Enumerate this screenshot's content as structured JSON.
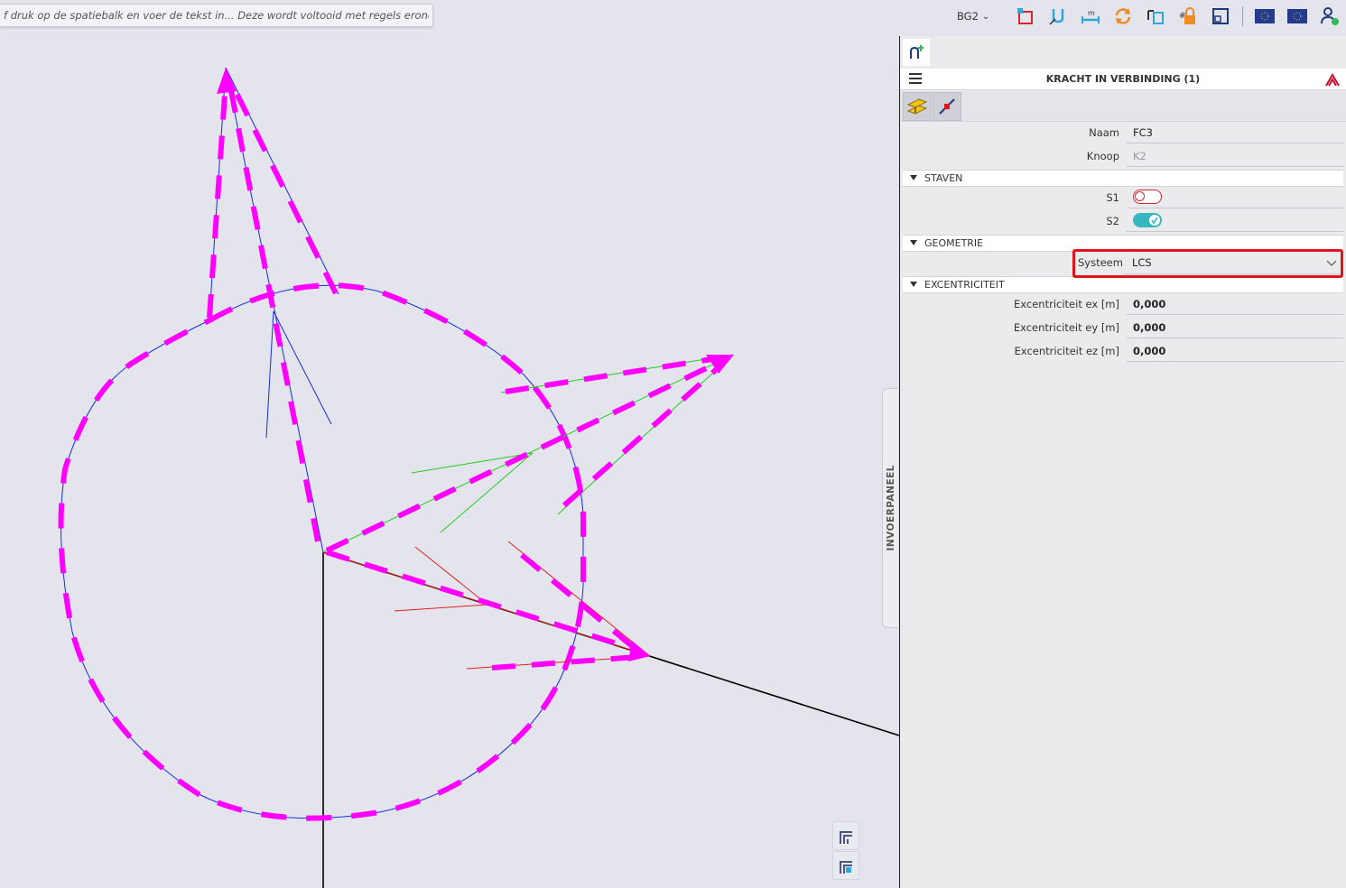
{
  "command_line": {
    "placeholder": "f druk op de spatiebalk en voer de tekst in... Deze wordt voltooid met regels eronder."
  },
  "toolbar": {
    "load_group": "BG2",
    "icons": [
      "structure-icon",
      "support-icon",
      "dimension-icon",
      "refresh-icon",
      "model-icon",
      "lock-icon",
      "view-icon",
      "eurocode-flag-icon",
      "eurocode-flag-icon",
      "user-icon"
    ]
  },
  "side_tab": {
    "label": "INVOERPANEEL"
  },
  "panel": {
    "title": "KRACHT IN VERBINDING (1)",
    "properties": {
      "naam": {
        "label": "Naam",
        "value": "FC3"
      },
      "knoop": {
        "label": "Knoop",
        "value": "K2"
      }
    },
    "sections": {
      "staven": {
        "title": "STAVEN",
        "items": [
          {
            "label": "S1",
            "enabled": false
          },
          {
            "label": "S2",
            "enabled": true
          }
        ]
      },
      "geometrie": {
        "title": "GEOMETRIE",
        "systeem": {
          "label": "Systeem",
          "value": "LCS"
        }
      },
      "excentriciteit": {
        "title": "EXCENTRICITEIT",
        "items": [
          {
            "label": "Excentriciteit ex [m]",
            "value": "0,000"
          },
          {
            "label": "Excentriciteit ey [m]",
            "value": "0,000"
          },
          {
            "label": "Excentriciteit ez [m]",
            "value": "0,000"
          }
        ]
      }
    }
  },
  "colors": {
    "moment": "#ff00ff",
    "x_axis": "#e02020",
    "y_axis": "#22cc22",
    "z_axis": "#1a2ed8",
    "highlight": "#e0141b",
    "toggle_on": "#38b6c0"
  }
}
